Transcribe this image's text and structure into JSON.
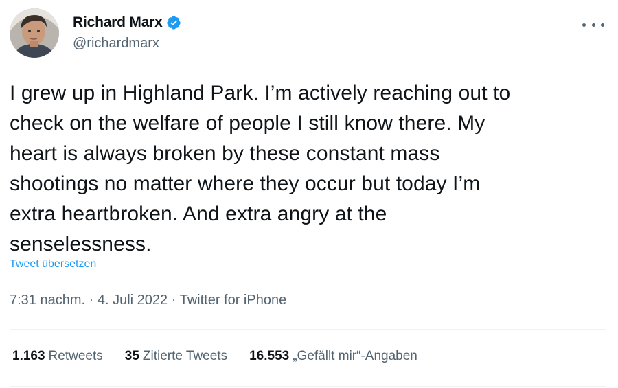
{
  "author": {
    "name": "Richard Marx",
    "handle": "@richardmarx",
    "verified": true,
    "avatar_icon": "avatar-portrait"
  },
  "tweet": {
    "text": "I grew up in Highland Park. I’m actively reaching out to check on the welfare of people I still know there. My heart is always broken by these constant mass shootings no matter where they occur but today I’m extra heartbroken. And extra angry at the senselessness.",
    "lines": [
      "I grew up in Highland Park. I’m actively reaching out to",
      "check on the welfare of people I still know there. My",
      "heart is always broken by these constant mass",
      "shootings no matter where they occur but today I’m",
      "extra heartbroken. And extra angry at the",
      "senselessness."
    ],
    "translate_label": "Tweet übersetzen",
    "time": "7:31 nachm.",
    "date": "4. Juli 2022",
    "source": "Twitter for iPhone",
    "separator": " · "
  },
  "stats": {
    "retweets": {
      "count": "1.163",
      "label": "Retweets"
    },
    "quotes": {
      "count": "35",
      "label": "Zitierte Tweets"
    },
    "likes": {
      "count": "16.553",
      "label": "„Gefällt mir“-Angaben"
    }
  },
  "colors": {
    "text": "#0f1419",
    "secondary": "#536471",
    "link": "#1d9bf0",
    "divider": "#eff3f4"
  }
}
